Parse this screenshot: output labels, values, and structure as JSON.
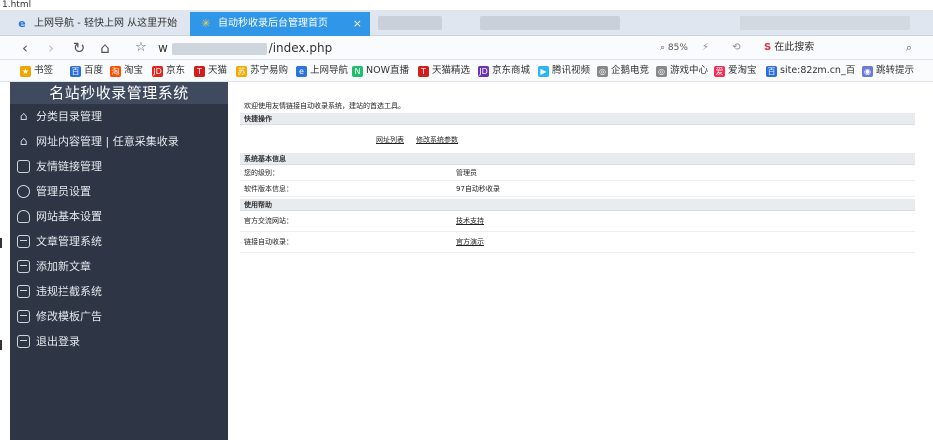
{
  "file_strip": "1.html",
  "browser": {
    "tabs": [
      {
        "label": "上网导航 - 轻快上网 从这里开始",
        "icon": "ie-icon",
        "active": false
      },
      {
        "label": "自动秒收录后台管理首页",
        "icon": "snowflake-icon",
        "active": true,
        "close": "×"
      }
    ],
    "nav": {
      "back": "‹",
      "forward": "›",
      "reload": "↻",
      "home": "⌂",
      "star": "☆"
    },
    "url": {
      "prefix": "w",
      "path": "/index.php"
    },
    "zoom": "85%",
    "addr_icons": "⚡ ⟲ ⌄",
    "search": {
      "brand": "S",
      "placeholder": "在此搜索",
      "icon": "⌕"
    },
    "bookmarks": [
      {
        "label": "书签",
        "icon": "★",
        "color": "#f0a500"
      },
      {
        "label": "百度",
        "icon": "百",
        "color": "#2b6de3"
      },
      {
        "label": "淘宝",
        "icon": "淘",
        "color": "#ff5000"
      },
      {
        "label": "京东",
        "icon": "JD",
        "color": "#e1251b"
      },
      {
        "label": "天猫",
        "icon": "T",
        "color": "#d41c1c"
      },
      {
        "label": "苏宁易购",
        "icon": "苏",
        "color": "#f7a800"
      },
      {
        "label": "上网导航",
        "icon": "e",
        "color": "#2b74d8"
      },
      {
        "label": "NOW直播",
        "icon": "N",
        "color": "#1fbf6b"
      },
      {
        "label": "天猫精选",
        "icon": "T",
        "color": "#d41c1c"
      },
      {
        "label": "京东商城",
        "icon": "JD",
        "color": "#6a33b8"
      },
      {
        "label": "腾讯视频",
        "icon": "▶",
        "color": "#29b6f6"
      },
      {
        "label": "企鹅电竞",
        "icon": "◎",
        "color": "#888888"
      },
      {
        "label": "游戏中心",
        "icon": "◎",
        "color": "#888888"
      },
      {
        "label": "爱淘宝",
        "icon": "爱",
        "color": "#ff2d55"
      },
      {
        "label": "site:82zm.cn_百",
        "icon": "百",
        "color": "#2b6de3"
      },
      {
        "label": "跳转提示",
        "icon": "◉",
        "color": "#6b7bd8"
      }
    ]
  },
  "sidebar": {
    "title": "名站秒收录管理系统",
    "items": [
      {
        "label": "分类目录管理",
        "icon": "building-icon"
      },
      {
        "label": "网址内容管理 | 任意采集收录",
        "icon": "building-icon"
      },
      {
        "label": "友情链接管理",
        "icon": "bag-icon"
      },
      {
        "label": "管理员设置",
        "icon": "admin-icon"
      },
      {
        "label": "网站基本设置",
        "icon": "user-icon"
      },
      {
        "label": "文章管理系统",
        "icon": "card-icon"
      },
      {
        "label": "添加新文章",
        "icon": "card-icon"
      },
      {
        "label": "违规拦截系统",
        "icon": "card-icon"
      },
      {
        "label": "修改模板广告",
        "icon": "card-icon"
      },
      {
        "label": "退出登录",
        "icon": "card-icon"
      }
    ]
  },
  "main": {
    "welcome": "欢迎使用友情链接自动收录系统，建站的首选工具。",
    "quick": {
      "title": "快捷操作",
      "links": [
        "网址列表",
        "修改系统参数"
      ]
    },
    "sysinfo": {
      "title": "系统基本信息",
      "rows": [
        {
          "label": "您的级别：",
          "value": "管理员"
        },
        {
          "label": "软件版本信息：",
          "value": "97自动秒收录"
        }
      ]
    },
    "help": {
      "title": "使用帮助",
      "rows": [
        {
          "label": "官方交流网站：",
          "value": "技术支持"
        },
        {
          "label": "链接自动收录：",
          "value": "官方演示"
        }
      ]
    }
  }
}
